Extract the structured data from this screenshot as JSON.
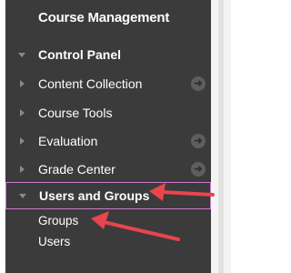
{
  "menu": {
    "title": "Course Management",
    "control_panel": "Control Panel",
    "items": [
      {
        "label": "Content Collection",
        "icon": "arrow-right-circle-icon"
      },
      {
        "label": "Course Tools"
      },
      {
        "label": "Evaluation",
        "icon": "arrow-right-circle-icon"
      },
      {
        "label": "Grade Center",
        "icon": "arrow-right-circle-icon"
      }
    ],
    "users_and_groups": "Users and Groups",
    "subitems": [
      "Groups",
      "Users"
    ]
  },
  "colors": {
    "panel_bg": "#3b3b3b",
    "highlight_border": "#cc79cc",
    "annotation_arrow": "#e8454d"
  }
}
